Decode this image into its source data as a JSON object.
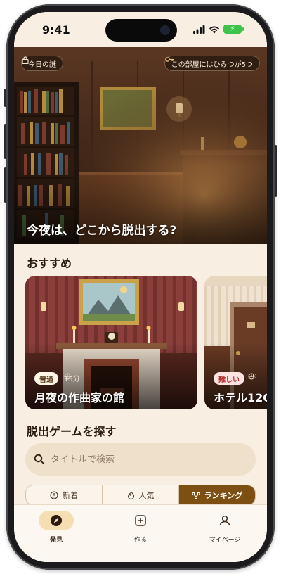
{
  "status_bar": {
    "time": "9:41"
  },
  "hero": {
    "badge_left": "今日の謎",
    "badge_right": "この部屋にはひみつが5つ",
    "title": "今夜は、どこから脱出する?"
  },
  "recommended": {
    "title": "おすすめ",
    "cards": [
      {
        "difficulty": "普通",
        "time": "15分",
        "title": "月夜の作曲家の館"
      },
      {
        "difficulty": "難しい",
        "time": "20",
        "title": "ホテル12C"
      }
    ]
  },
  "explore": {
    "title": "脱出ゲームを探す",
    "search_placeholder": "タイトルで検索",
    "tabs": [
      {
        "label": "新着",
        "icon": "alert-circle-icon"
      },
      {
        "label": "人気",
        "icon": "flame-icon"
      },
      {
        "label": "ランキング",
        "icon": "trophy-icon",
        "active": true
      }
    ]
  },
  "bottom_nav": {
    "items": [
      {
        "label": "発見",
        "icon": "compass-icon",
        "active": true
      },
      {
        "label": "作る",
        "icon": "plus-square-icon"
      },
      {
        "label": "マイページ",
        "icon": "user-icon"
      }
    ]
  },
  "colors": {
    "background": "#f8efe2",
    "accent": "#7d4f12",
    "badge_normal": "#fff6e6",
    "badge_hard": "#fde3e1"
  }
}
